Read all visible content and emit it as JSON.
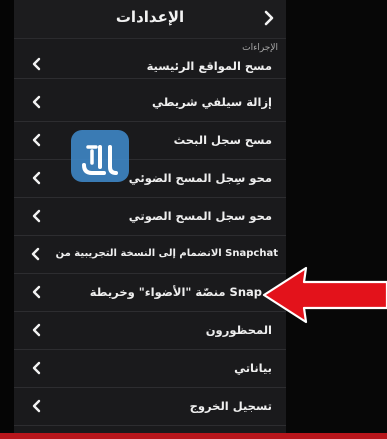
{
  "header": {
    "title": "الإعدادات"
  },
  "section_label": "الإجراءات",
  "rows": [
    {
      "label": "مسح المواقع الرئيسية"
    },
    {
      "label": "إزالة سيلفي شريطي"
    },
    {
      "label": "مسح سجل البحث"
    },
    {
      "label": "محو سِجل المسح الضوئي"
    },
    {
      "label": "محو سجل المسح الصوتي"
    },
    {
      "label": "الانضمام إلى النسخة التجريبية من Snapchat"
    },
    {
      "label": "منصّة \"الأضواء\" وخريطة Snap"
    },
    {
      "label": "المحظورون"
    },
    {
      "label": "بياناتي"
    },
    {
      "label": "تسجيل الخروج"
    }
  ],
  "watermark": {
    "text": "المرجع"
  },
  "colors": {
    "arrow": "#e3121b",
    "watermark": "#3f89c9",
    "panel": "#1a1a1c",
    "text": "#efefef"
  },
  "icons": {
    "back": "chevron-right-icon",
    "row": "chevron-left-icon",
    "annotation": "red-arrow-icon"
  }
}
